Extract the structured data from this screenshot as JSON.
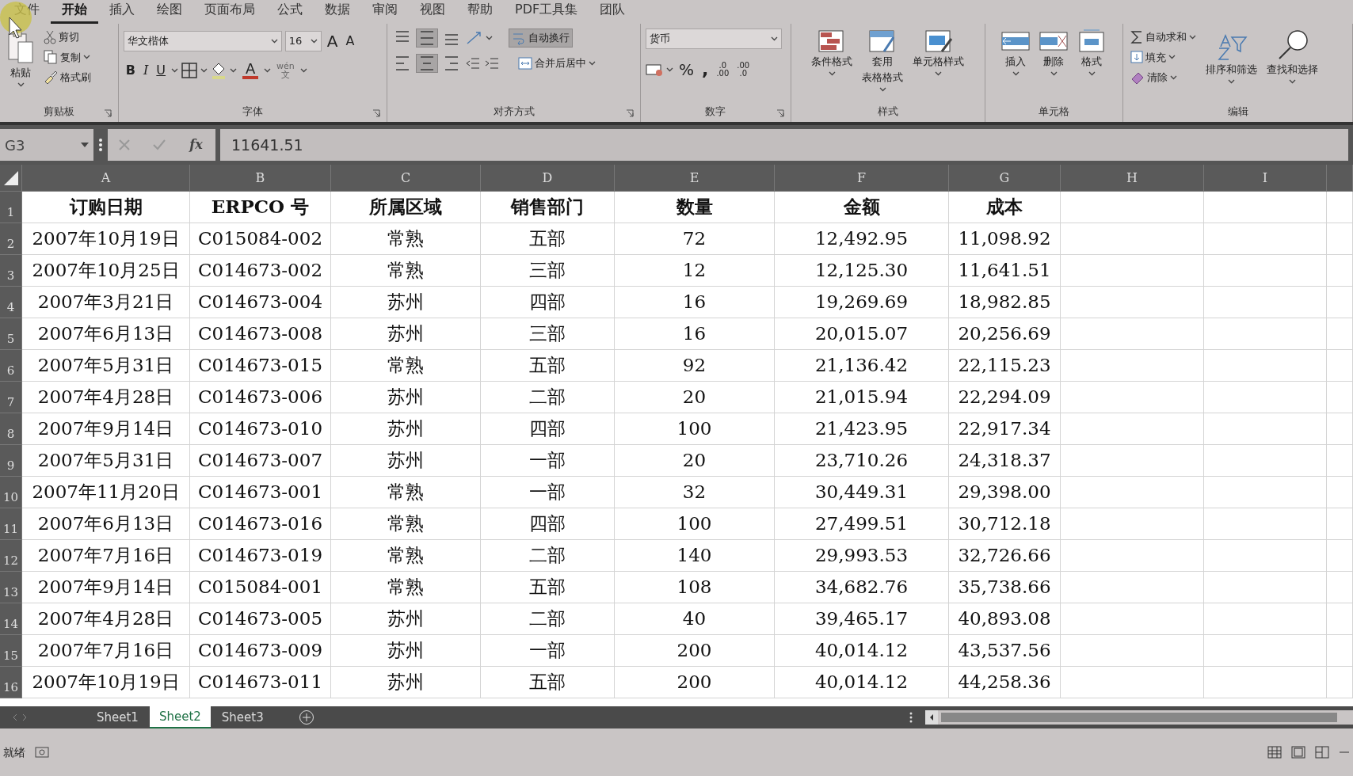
{
  "menu_tabs": [
    {
      "label": "文件",
      "selected": false
    },
    {
      "label": "开始",
      "selected": true
    },
    {
      "label": "插入",
      "selected": false
    },
    {
      "label": "绘图",
      "selected": false
    },
    {
      "label": "页面布局",
      "selected": false
    },
    {
      "label": "公式",
      "selected": false
    },
    {
      "label": "数据",
      "selected": false
    },
    {
      "label": "审阅",
      "selected": false
    },
    {
      "label": "视图",
      "selected": false
    },
    {
      "label": "帮助",
      "selected": false
    },
    {
      "label": "PDF工具集",
      "selected": false
    },
    {
      "label": "团队",
      "selected": false
    }
  ],
  "ribbon": {
    "clipboard": {
      "title": "剪贴板",
      "paste": "粘贴",
      "cut": "剪切",
      "copy": "复制",
      "format_painter": "格式刷"
    },
    "font": {
      "title": "字体",
      "font_name": "华文楷体",
      "font_size": "16",
      "grow": "A",
      "shrink": "A",
      "bold": "B",
      "italic": "I",
      "underline": "U",
      "font_color": "A",
      "phonetic_top": "wén",
      "phonetic_bottom": "文"
    },
    "alignment": {
      "title": "对齐方式",
      "vertical": [
        {
          "on": false
        },
        {
          "on": true
        },
        {
          "on": false
        }
      ],
      "horizontal": [
        {
          "on": false
        },
        {
          "on": true
        },
        {
          "on": false
        }
      ],
      "wrap_text": {
        "label": "自动换行",
        "on": true
      },
      "merge_center": "合并后居中"
    },
    "number": {
      "title": "数字",
      "format": "货币",
      "percent": "%",
      "comma": ",",
      "inc_top": ".0",
      "inc_bottom": ".00",
      "dec_top": ".00",
      "dec_bottom": ".0"
    },
    "styles": {
      "title": "样式",
      "buttons": [
        {
          "lines": [
            "条件格式"
          ]
        },
        {
          "lines": [
            "套用",
            "表格格式"
          ]
        },
        {
          "lines": [
            "单元格样式"
          ]
        }
      ]
    },
    "cells": {
      "title": "单元格",
      "buttons": [
        "插入",
        "删除",
        "格式"
      ]
    },
    "editing": {
      "title": "编辑",
      "autosum": "自动求和",
      "fill": "填充",
      "clear": "清除",
      "sort_filter": "排序和筛选",
      "find_select": "查找和选择"
    }
  },
  "formula_bar": {
    "name_box": "G3",
    "function_label": "fx",
    "value": "11641.51"
  },
  "columns": [
    "A",
    "B",
    "C",
    "D",
    "E",
    "F",
    "G",
    "H",
    "I"
  ],
  "rows": [
    {
      "number": "1",
      "header": true,
      "cells": [
        "订购日期",
        "ERPCO 号",
        "所属区域",
        "销售部门",
        "数量",
        "金额",
        "成本"
      ]
    },
    {
      "number": "2",
      "header": false,
      "cells": [
        "2007年10月19日",
        "C015084-002",
        "常熟",
        "五部",
        "72",
        "12,492.95",
        "11,098.92"
      ]
    },
    {
      "number": "3",
      "header": false,
      "cells": [
        "2007年10月25日",
        "C014673-002",
        "常熟",
        "三部",
        "12",
        "12,125.30",
        "11,641.51"
      ]
    },
    {
      "number": "4",
      "header": false,
      "cells": [
        "2007年3月21日",
        "C014673-004",
        "苏州",
        "四部",
        "16",
        "19,269.69",
        "18,982.85"
      ]
    },
    {
      "number": "5",
      "header": false,
      "cells": [
        "2007年6月13日",
        "C014673-008",
        "苏州",
        "三部",
        "16",
        "20,015.07",
        "20,256.69"
      ]
    },
    {
      "number": "6",
      "header": false,
      "cells": [
        "2007年5月31日",
        "C014673-015",
        "常熟",
        "五部",
        "92",
        "21,136.42",
        "22,115.23"
      ]
    },
    {
      "number": "7",
      "header": false,
      "cells": [
        "2007年4月28日",
        "C014673-006",
        "苏州",
        "二部",
        "20",
        "21,015.94",
        "22,294.09"
      ]
    },
    {
      "number": "8",
      "header": false,
      "cells": [
        "2007年9月14日",
        "C014673-010",
        "苏州",
        "四部",
        "100",
        "21,423.95",
        "22,917.34"
      ]
    },
    {
      "number": "9",
      "header": false,
      "cells": [
        "2007年5月31日",
        "C014673-007",
        "苏州",
        "一部",
        "20",
        "23,710.26",
        "24,318.37"
      ]
    },
    {
      "number": "10",
      "header": false,
      "cells": [
        "2007年11月20日",
        "C014673-001",
        "常熟",
        "一部",
        "32",
        "30,449.31",
        "29,398.00"
      ]
    },
    {
      "number": "11",
      "header": false,
      "cells": [
        "2007年6月13日",
        "C014673-016",
        "常熟",
        "四部",
        "100",
        "27,499.51",
        "30,712.18"
      ]
    },
    {
      "number": "12",
      "header": false,
      "cells": [
        "2007年7月16日",
        "C014673-019",
        "常熟",
        "二部",
        "140",
        "29,993.53",
        "32,726.66"
      ]
    },
    {
      "number": "13",
      "header": false,
      "cells": [
        "2007年9月14日",
        "C015084-001",
        "常熟",
        "五部",
        "108",
        "34,682.76",
        "35,738.66"
      ]
    },
    {
      "number": "14",
      "header": false,
      "cells": [
        "2007年4月28日",
        "C014673-005",
        "苏州",
        "二部",
        "40",
        "39,465.17",
        "40,893.08"
      ]
    },
    {
      "number": "15",
      "header": false,
      "cells": [
        "2007年7月16日",
        "C014673-009",
        "苏州",
        "一部",
        "200",
        "40,014.12",
        "43,537.56"
      ]
    },
    {
      "number": "16",
      "header": false,
      "cells": [
        "2007年10月19日",
        "C014673-011",
        "苏州",
        "五部",
        "200",
        "40,014.12",
        "44,258.36"
      ]
    }
  ],
  "sheets": [
    {
      "label": "Sheet1",
      "selected": false
    },
    {
      "label": "Sheet2",
      "selected": true
    },
    {
      "label": "Sheet3",
      "selected": false
    }
  ],
  "status": "就绪"
}
